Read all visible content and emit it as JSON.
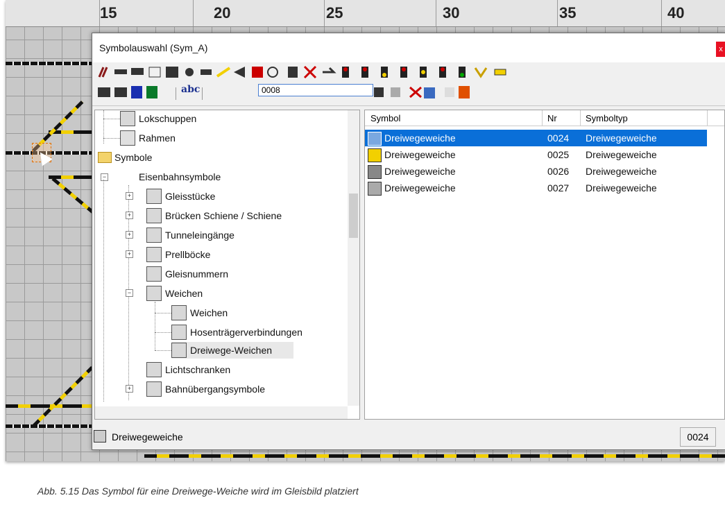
{
  "ruler": {
    "labels": [
      "15",
      "20",
      "25",
      "30",
      "35",
      "40"
    ]
  },
  "window": {
    "title": "Symbolauswahl (Sym_A)",
    "close_label": "x"
  },
  "toolbar": {
    "abc_label": "abc",
    "search_value": "0008"
  },
  "tree": {
    "nodes": [
      {
        "label": "Lokschuppen"
      },
      {
        "label": "Rahmen"
      },
      {
        "label": "Symbole"
      },
      {
        "label": "Eisenbahnsymbole"
      },
      {
        "label": "Gleisstücke"
      },
      {
        "label": "Brücken Schiene / Schiene"
      },
      {
        "label": "Tunneleingänge"
      },
      {
        "label": "Prellböcke"
      },
      {
        "label": "Gleisnummern"
      },
      {
        "label": "Weichen"
      },
      {
        "label": "Weichen"
      },
      {
        "label": "Hosenträgerverbindungen"
      },
      {
        "label": "Dreiwege-Weichen"
      },
      {
        "label": "Lichtschranken"
      },
      {
        "label": "Bahnübergangsymbole"
      }
    ]
  },
  "list": {
    "columns": [
      "Symbol",
      "Nr",
      "Symboltyp"
    ],
    "rows": [
      {
        "symbol": "Dreiwegeweiche",
        "nr": "0024",
        "type": "Dreiwegeweiche"
      },
      {
        "symbol": "Dreiwegeweiche",
        "nr": "0025",
        "type": "Dreiwegeweiche"
      },
      {
        "symbol": "Dreiwegeweiche",
        "nr": "0026",
        "type": "Dreiwegeweiche"
      },
      {
        "symbol": "Dreiwegeweiche",
        "nr": "0027",
        "type": "Dreiwegeweiche"
      }
    ]
  },
  "status": {
    "text": "Dreiwegeweiche",
    "number": "0024"
  },
  "caption": "Abb. 5.15    Das Symbol für eine Dreiwege-Weiche wird im Gleisbild platziert",
  "colors": {
    "selection": "#0a6fd8",
    "track_yellow": "#f2d000",
    "grid": "#c8c8c8"
  }
}
